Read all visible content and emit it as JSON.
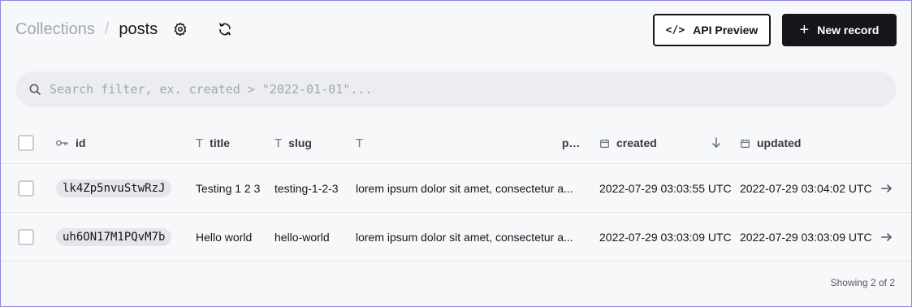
{
  "breadcrumb": {
    "parent": "Collections",
    "separator": "/",
    "current": "posts"
  },
  "toolbar": {
    "api_preview_label": "API Preview",
    "new_record_label": "New record"
  },
  "search": {
    "placeholder": "Search filter, ex. created > \"2022-01-01\"...",
    "value": ""
  },
  "table": {
    "columns": [
      {
        "key": "id",
        "label": "id",
        "icon": "key-icon"
      },
      {
        "key": "title",
        "label": "title",
        "icon": "text-icon"
      },
      {
        "key": "slug",
        "label": "slug",
        "icon": "text-icon"
      },
      {
        "key": "post",
        "label": "post",
        "icon": "text-icon"
      },
      {
        "key": "created",
        "label": "created",
        "icon": "calendar-icon",
        "sorted": "desc"
      },
      {
        "key": "updated",
        "label": "updated",
        "icon": "calendar-icon"
      }
    ],
    "rows": [
      {
        "id": "lk4Zp5nvuStwRzJ",
        "title": "Testing 1 2 3",
        "slug": "testing-1-2-3",
        "post": "lorem ipsum dolor sit amet, consectetur a...",
        "created": "2022-07-29 03:03:55 UTC",
        "updated": "2022-07-29 03:04:02 UTC"
      },
      {
        "id": "uh6ON17M1PQvM7b",
        "title": "Hello world",
        "slug": "hello-world",
        "post": "lorem ipsum dolor sit amet, consectetur a...",
        "created": "2022-07-29 03:03:09 UTC",
        "updated": "2022-07-29 03:03:09 UTC"
      }
    ]
  },
  "footer": {
    "showing": "Showing 2 of 2"
  },
  "colors": {
    "accent_dark": "#16161a",
    "frame_border": "#8f86e6",
    "background": "#f7f8fa"
  }
}
